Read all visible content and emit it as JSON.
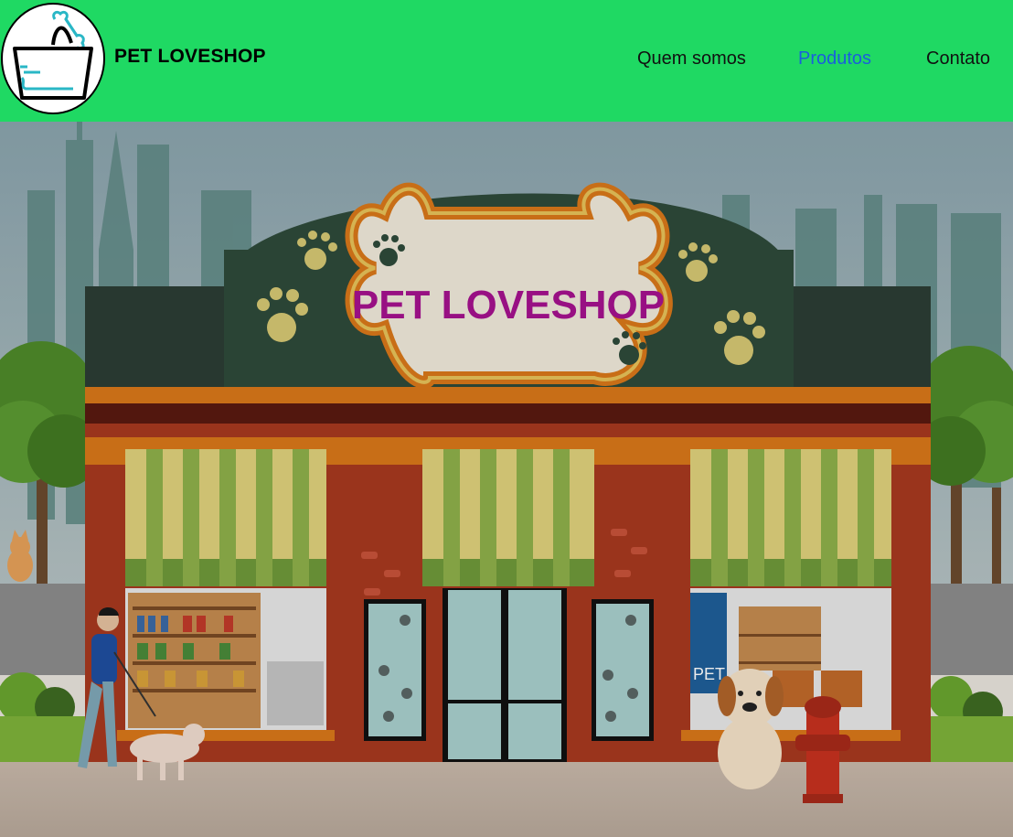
{
  "header": {
    "brand": "PET LOVESHOP",
    "logo_icon": "shopping-basket-bone-icon",
    "background_color": "#1fd963"
  },
  "nav": {
    "items": [
      {
        "label": "Quem somos",
        "color": "#111111",
        "active": false
      },
      {
        "label": "Produtos",
        "color": "#1a5fdc",
        "active": true
      },
      {
        "label": "Contato",
        "color": "#111111",
        "active": false
      }
    ]
  },
  "hero": {
    "sign_text": "PET LOVESHOP",
    "window_poster_text": "PET",
    "illustration": "pet-shop-storefront-illustration"
  }
}
